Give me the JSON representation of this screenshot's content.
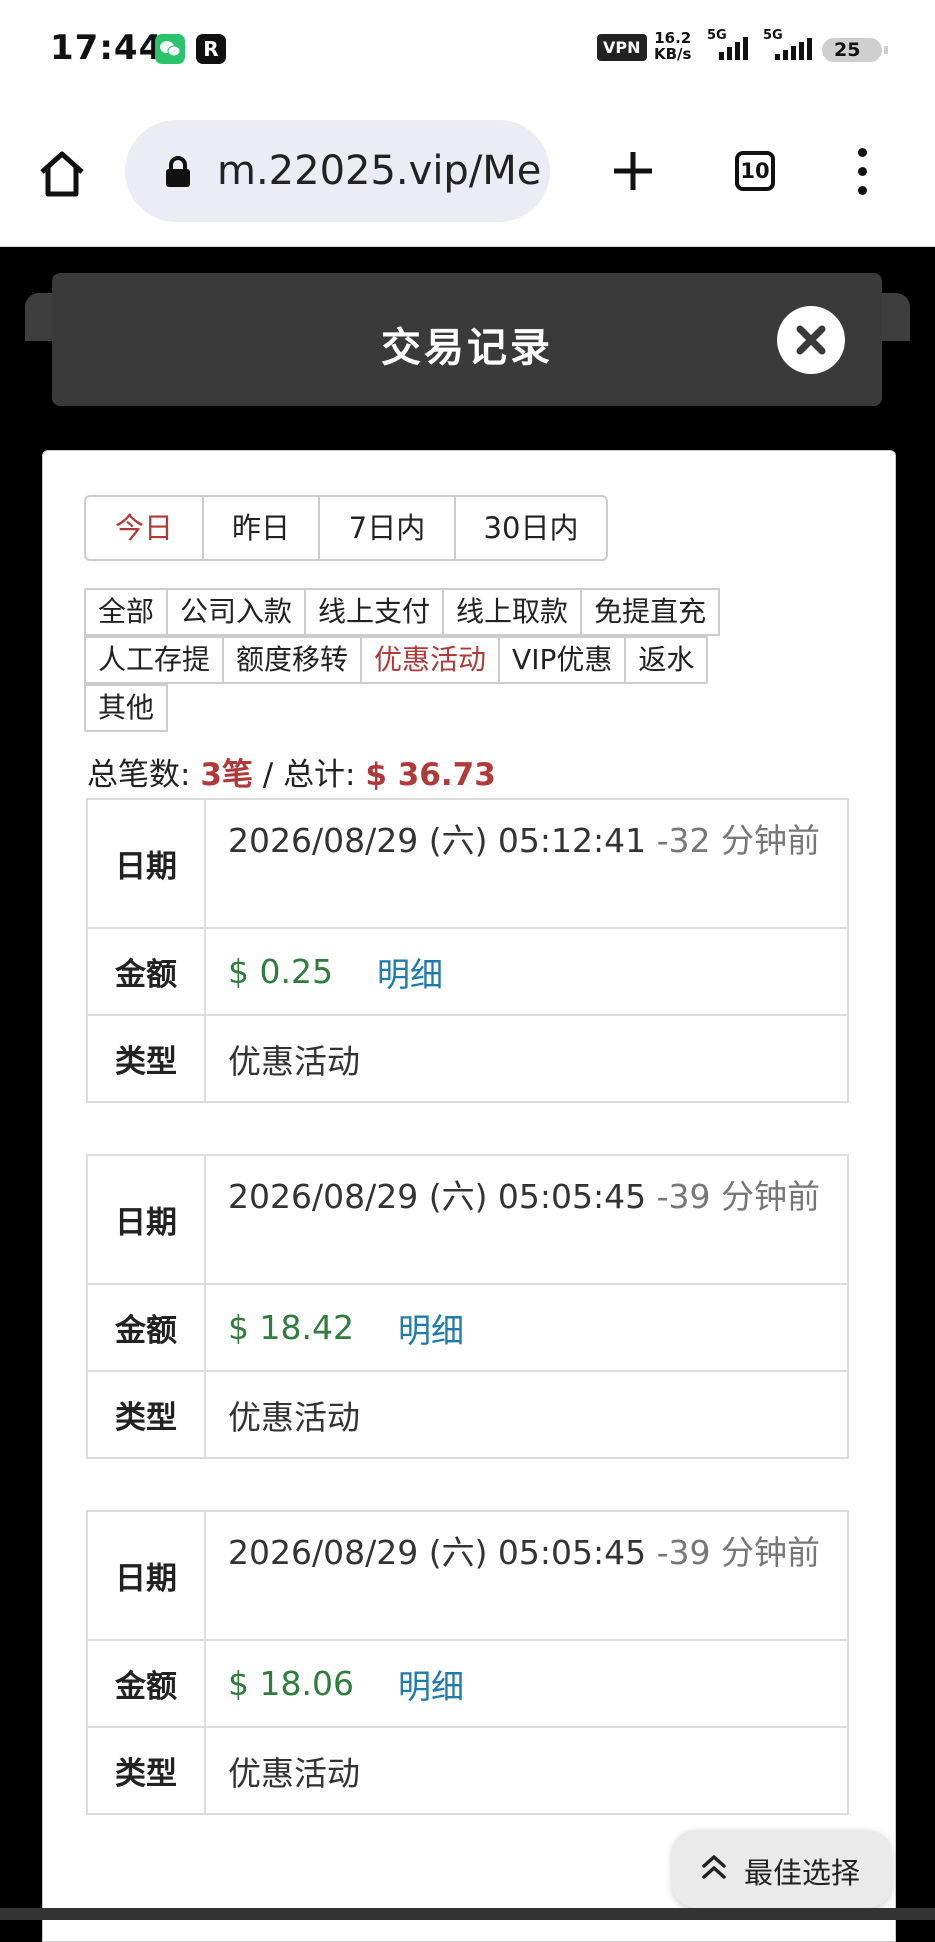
{
  "status": {
    "time": "17:44",
    "wechat_icon": "wechat-icon",
    "r_icon": "R",
    "vpn": "VPN",
    "speed_value": "16.2",
    "speed_unit": "KB/s",
    "sim1": "5G",
    "sim2": "5G",
    "battery": "25"
  },
  "browser": {
    "url": "m.22025.vip/Me",
    "tab_count": "10"
  },
  "modal": {
    "title": "交易记录"
  },
  "date_filters": [
    {
      "label": "今日",
      "active": true
    },
    {
      "label": "昨日"
    },
    {
      "label": "7日内"
    },
    {
      "label": "30日内"
    }
  ],
  "categories_row1": [
    "全部",
    "公司入款",
    "线上支付",
    "线上取款",
    "免提直充"
  ],
  "categories_row2": [
    "人工存提",
    "额度移转",
    "优惠活动",
    "VIP优惠",
    "返水"
  ],
  "categories_row3": [
    "其他"
  ],
  "active_category": "优惠活动",
  "summary": {
    "count_label": "总笔数:",
    "count": "3笔",
    "sep": "/",
    "total_label": "总计:",
    "total": "$ 36.73"
  },
  "labels": {
    "date": "日期",
    "amount": "金额",
    "type": "类型",
    "detail": "明细"
  },
  "records": [
    {
      "date": "2026/08/29 (六) 05:12:41",
      "ago": "-32 分钟前",
      "amount": "$ 0.25",
      "type": "优惠活动"
    },
    {
      "date": "2026/08/29 (六) 05:05:45",
      "ago": "-39 分钟前",
      "amount": "$ 18.42",
      "type": "优惠活动"
    },
    {
      "date": "2026/08/29 (六) 05:05:45",
      "ago": "-39 分钟前",
      "amount": "$ 18.06",
      "type": "优惠活动"
    }
  ],
  "float_button": {
    "label": "最佳选择",
    "icon": "double-chevron-up-icon"
  },
  "colors": {
    "active_red": "#b03a3a",
    "amount_green": "#2e7d3c",
    "link_blue": "#1f7bab",
    "header_bg": "#3a3a3a"
  }
}
